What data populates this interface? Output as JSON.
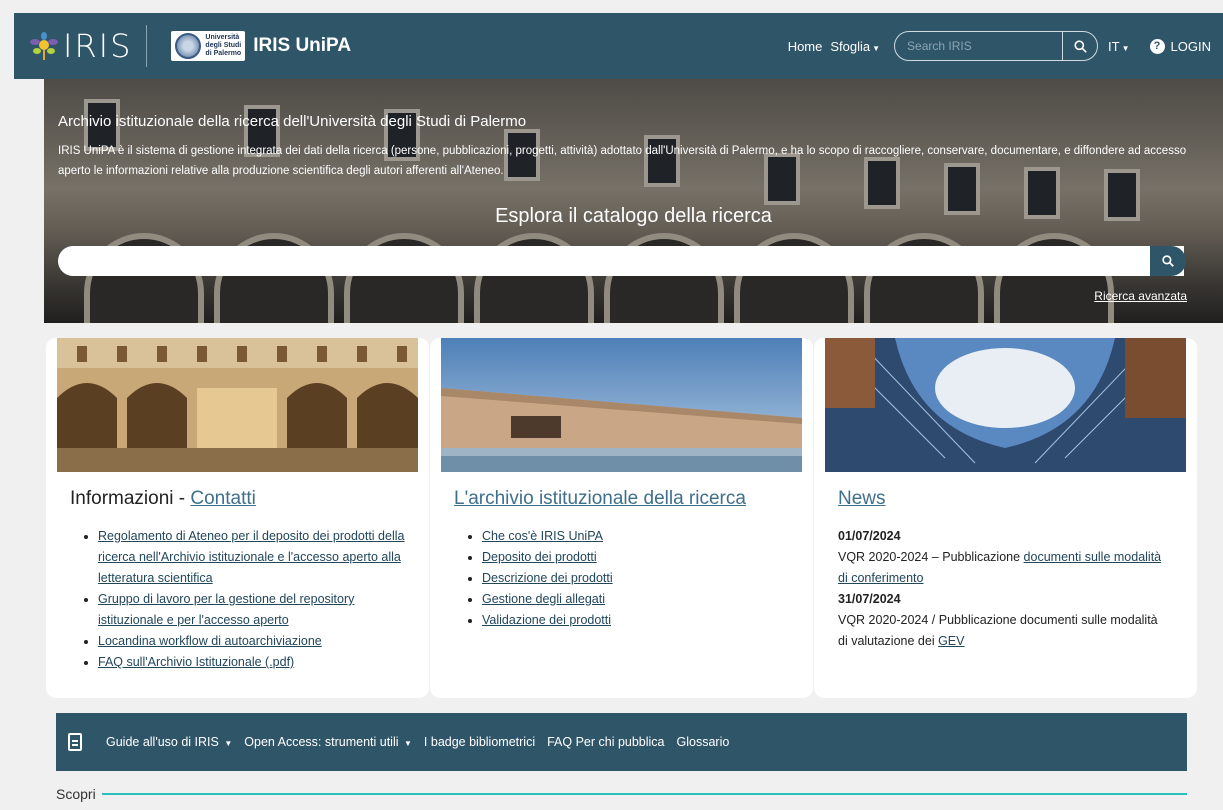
{
  "navbar": {
    "brand_text": "IRIS",
    "unipa_small": [
      "Università",
      "degli Studi",
      "di Palermo"
    ],
    "unipa_title": "IRIS UniPA",
    "home": "Home",
    "browse": "Sfoglia",
    "search_placeholder": "Search IRIS",
    "language": "IT",
    "login": "LOGIN"
  },
  "hero": {
    "title": "Archivio istituzionale della ricerca dell'Università degli Studi di Palermo",
    "description": "IRIS UniPA è il sistema di gestione integrata dei dati della ricerca (persone, pubblicazioni, progetti, attività) adottato dall'Università di Palermo, e ha lo scopo di raccogliere, conservare, documentare, e diffondere ad accesso aperto le informazioni relative alla produzione scientifica degli autori afferenti all'Ateneo.",
    "explore": "Esplora il catalogo della ricerca",
    "advanced": "Ricerca avanzata"
  },
  "cards": {
    "info": {
      "title_prefix": "Informazioni - ",
      "title_link": "Contatti",
      "items": [
        "Regolamento di Ateneo per il deposito dei prodotti della ricerca nell'Archivio istituzionale e l'accesso aperto alla letteratura scientifica",
        "Gruppo di lavoro per la gestione del repository istituzionale e per l'accesso aperto",
        "Locandina workflow di autoarchiviazione",
        "FAQ sull'Archivio Istituzionale (.pdf)"
      ]
    },
    "archive": {
      "title": "L'archivio istituzionale della ricerca",
      "items": [
        "Che cos'è IRIS UniPA",
        "Deposito dei prodotti",
        "Descrizione dei prodotti",
        "Gestione degli allegati",
        "Validazione dei prodotti"
      ]
    },
    "news": {
      "title": "News",
      "entries": [
        {
          "date": "01/07/2024",
          "text": "VQR 2020-2024 – Pubblicazione ",
          "link": "documenti sulle modalità di conferimento"
        },
        {
          "date": "31/07/2024",
          "text": "VQR 2020-2024 / Pubblicazione documenti sulle modalità di valutazione dei ",
          "link": "GEV"
        }
      ]
    }
  },
  "subnav": {
    "items": [
      "Guide all'uso di IRIS",
      "Open Access: strumenti utili",
      "I badge bibliometrici",
      "FAQ Per chi pubblica",
      "Glossario"
    ]
  },
  "section": {
    "scopri": "Scopri"
  },
  "colors": {
    "primary": "#2f5569",
    "accent": "#2cc0bd",
    "link": "#3f6f8c"
  }
}
